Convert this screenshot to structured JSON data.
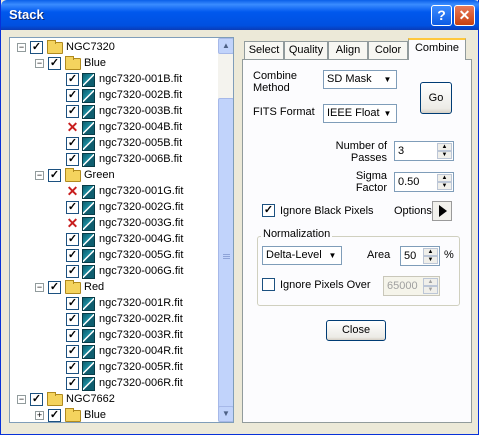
{
  "window": {
    "title": "Stack",
    "help_label": "?",
    "close_label": "✕"
  },
  "tree": {
    "groups": [
      {
        "name": "NGC7320",
        "checked": true,
        "expanded": true,
        "channels": [
          {
            "name": "Blue",
            "files": [
              {
                "name": "ngc7320-001B.fit",
                "status": "ok"
              },
              {
                "name": "ngc7320-002B.fit",
                "status": "ok"
              },
              {
                "name": "ngc7320-003B.fit",
                "status": "ok"
              },
              {
                "name": "ngc7320-004B.fit",
                "status": "rejected"
              },
              {
                "name": "ngc7320-005B.fit",
                "status": "ok"
              },
              {
                "name": "ngc7320-006B.fit",
                "status": "ok"
              }
            ]
          },
          {
            "name": "Green",
            "files": [
              {
                "name": "ngc7320-001G.fit",
                "status": "rejected"
              },
              {
                "name": "ngc7320-002G.fit",
                "status": "ok"
              },
              {
                "name": "ngc7320-003G.fit",
                "status": "rejected"
              },
              {
                "name": "ngc7320-004G.fit",
                "status": "ok"
              },
              {
                "name": "ngc7320-005G.fit",
                "status": "ok"
              },
              {
                "name": "ngc7320-006G.fit",
                "status": "ok"
              }
            ]
          },
          {
            "name": "Red",
            "files": [
              {
                "name": "ngc7320-001R.fit",
                "status": "ok"
              },
              {
                "name": "ngc7320-002R.fit",
                "status": "ok"
              },
              {
                "name": "ngc7320-003R.fit",
                "status": "ok"
              },
              {
                "name": "ngc7320-004R.fit",
                "status": "ok"
              },
              {
                "name": "ngc7320-005R.fit",
                "status": "ok"
              },
              {
                "name": "ngc7320-006R.fit",
                "status": "ok"
              }
            ]
          }
        ]
      },
      {
        "name": "NGC7662",
        "checked": true,
        "expanded": true,
        "channels": [
          {
            "name": "Blue",
            "collapsed": true,
            "files": []
          }
        ]
      }
    ]
  },
  "tabs": [
    "Select",
    "Quality",
    "Align",
    "Color",
    "Combine"
  ],
  "active_tab": "Combine",
  "combine": {
    "method_label": "Combine\nMethod",
    "method_value": "SD Mask",
    "format_label": "FITS Format",
    "format_value": "IEEE Float",
    "go_label": "Go",
    "passes_label": "Number of\nPasses",
    "passes_value": "3",
    "sigma_label": "Sigma\nFactor",
    "sigma_value": "0.50",
    "ignore_black_label": "Ignore Black Pixels",
    "ignore_black_checked": true,
    "options_label": "Options",
    "normalization_label": "Normalization",
    "normalization_value": "Delta-Level",
    "area_label": "Area",
    "area_value": "50",
    "area_unit": "%",
    "ignore_over_label": "Ignore Pixels Over",
    "ignore_over_checked": false,
    "ignore_over_value": "65000",
    "close_label": "Close"
  }
}
